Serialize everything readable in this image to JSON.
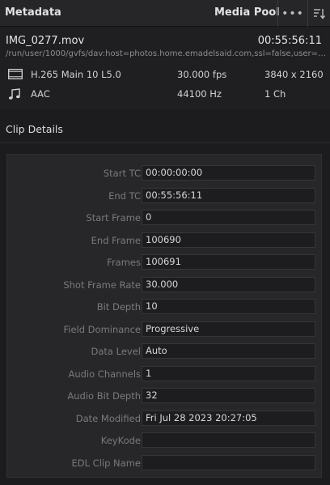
{
  "header": {
    "title": "Metadata",
    "media_pool_label": "Media Pool",
    "more_label": "•••"
  },
  "file": {
    "name": "IMG_0277.mov",
    "duration": "00:55:56:11",
    "path": "/run/user/1000/gvfs/dav:host=photos.home.emadelsaid.com,ssl=false,user=a..."
  },
  "video": {
    "icon": "film-strip-icon",
    "codec": "H.265 Main 10 L5.0",
    "fps": "30.000 fps",
    "resolution": "3840 x 2160"
  },
  "audio": {
    "icon": "music-note-icon",
    "codec": "AAC",
    "rate": "44100 Hz",
    "channels": "1 Ch"
  },
  "section": {
    "title": "Clip Details"
  },
  "fields": [
    {
      "label": "Start TC",
      "value": "00:00:00:00"
    },
    {
      "label": "End TC",
      "value": "00:55:56:11"
    },
    {
      "label": "Start Frame",
      "value": "0"
    },
    {
      "label": "End Frame",
      "value": "100690"
    },
    {
      "label": "Frames",
      "value": "100691"
    },
    {
      "label": "Shot Frame Rate",
      "value": "30.000"
    },
    {
      "label": "Bit Depth",
      "value": "10"
    },
    {
      "label": "Field Dominance",
      "value": "Progressive"
    },
    {
      "label": "Data Level",
      "value": "Auto"
    },
    {
      "label": "Audio Channels",
      "value": "1"
    },
    {
      "label": "Audio Bit Depth",
      "value": "32"
    },
    {
      "label": "Date Modified",
      "value": "Fri Jul 28 2023 20:27:05"
    },
    {
      "label": "KeyKode",
      "value": ""
    },
    {
      "label": "EDL Clip Name",
      "value": ""
    }
  ]
}
